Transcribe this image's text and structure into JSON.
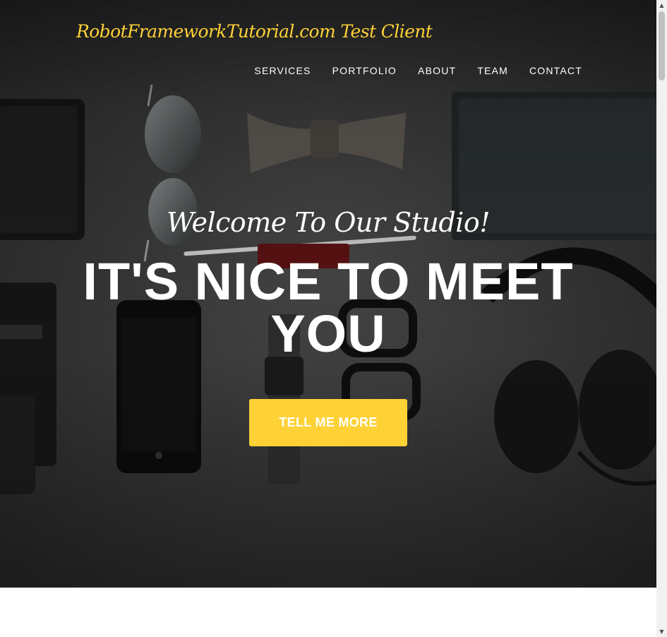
{
  "brand": {
    "title": "RobotFrameworkTutorial.com Test Client",
    "color": "#fed136"
  },
  "nav": {
    "items": [
      {
        "label": "SERVICES"
      },
      {
        "label": "PORTFOLIO"
      },
      {
        "label": "ABOUT"
      },
      {
        "label": "TEAM"
      },
      {
        "label": "CONTACT"
      }
    ]
  },
  "hero": {
    "subheading": "Welcome To Our Studio!",
    "heading": "IT'S NICE TO MEET YOU",
    "cta_label": "TELL ME MORE",
    "accent": "#fed136",
    "background_image": "flat-lay-accessories-photo"
  },
  "scrollbar": {
    "up_icon": "chevron-up-icon",
    "down_icon": "chevron-down-icon"
  }
}
